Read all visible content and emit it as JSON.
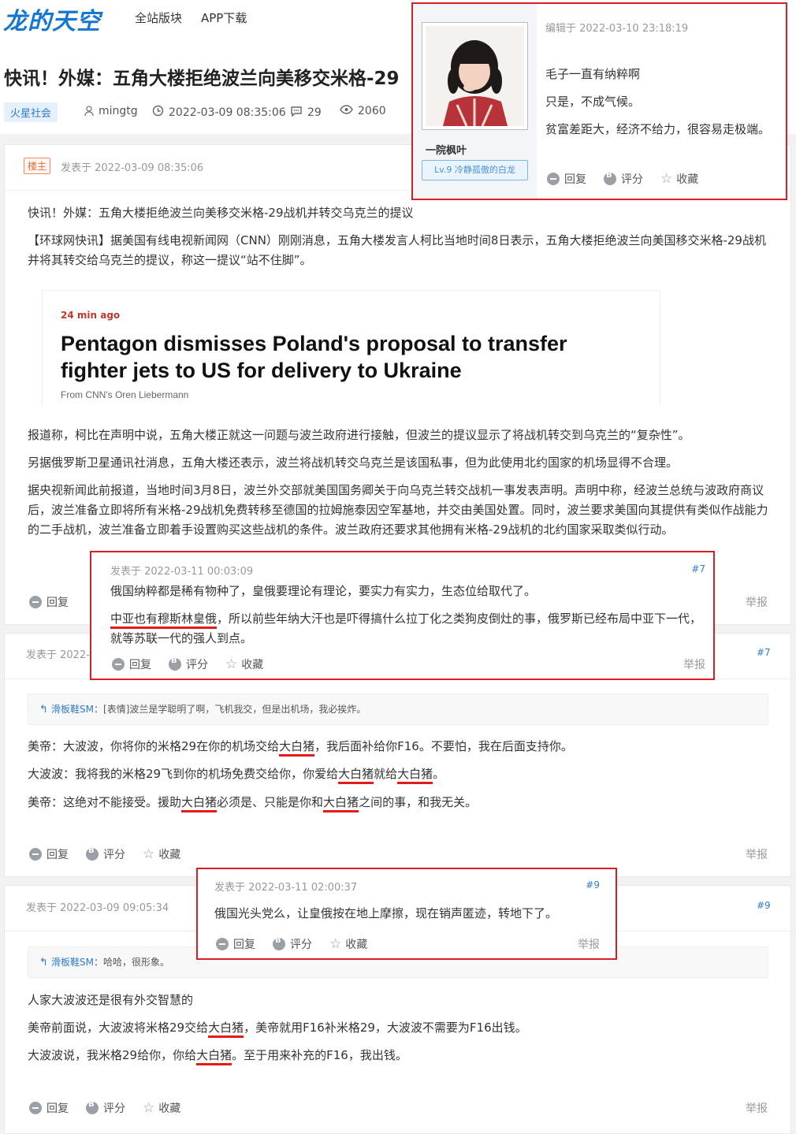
{
  "header": {
    "logo": "龙的天空",
    "nav": [
      "全站版块",
      "APP下载"
    ],
    "title": "快讯！外媒：五角大楼拒绝波兰向美移交米格-29",
    "tag": "火星社会",
    "author": "mingtg",
    "time": "2022-03-09 08:35:06",
    "replies": "29",
    "views": "2060"
  },
  "popup_user": {
    "edited": "编辑于 2022-03-10 23:18:19",
    "name": "一院枫叶",
    "level": "Lv.9 冷静孤傲的白龙",
    "lines": [
      "毛子一直有纳粹啊",
      "只是，不成气候。",
      "贫富差距大，经济不给力，很容易走极端。"
    ]
  },
  "actions": {
    "reply": "回复",
    "rate": "评分",
    "fav": "收藏",
    "report": "举报"
  },
  "post1": {
    "badge": "楼主",
    "time": "发表于 2022-03-09 08:35:06",
    "p1": "快讯！外媒：五角大楼拒绝波兰向美移交米格-29战机并转交乌克兰的提议",
    "p2": "【环球网快讯】据美国有线电视新闻网（CNN）刚刚消息，五角大楼发言人柯比当地时间8日表示，五角大楼拒绝波兰向美国移交米格-29战机并将其转交给乌克兰的提议，称这一提议“站不住脚”。",
    "cnn_time": "24 min ago",
    "cnn_head": "Pentagon dismisses Poland's proposal to transfer fighter jets to US for delivery to Ukraine",
    "cnn_by": "From CNN's Oren Liebermann",
    "p3": "报道称，柯比在声明中说，五角大楼正就这一问题与波兰政府进行接触，但波兰的提议显示了将战机转交到乌克兰的“复杂性”。",
    "p4": "另据俄罗斯卫星通讯社消息，五角大楼还表示，波兰将战机转交乌克兰是该国私事，但为此使用北约国家的机场显得不合理。",
    "p5": "据央视新闻此前报道，当地时间3月8日，波兰外交部就美国国务卿关于向乌克兰转交战机一事发表声明。声明中称，经波兰总统与波政府商议后，波兰准备立即将所有米格-29战机免费转移至德国的拉姆施泰因空军基地，并交由美国处置。同时，波兰要求美国向其提供有类似作战能力的二手战机，波兰准备立即着手设置购买这些战机的条件。波兰政府还要求其他拥有米格-29战机的北约国家采取类似行动。"
  },
  "popup7": {
    "time": "发表于 2022-03-11 00:03:09",
    "floor": "#7",
    "l1": "俄国纳粹都是稀有物种了，皇俄要理论有理论，要实力有实力，生态位给取代了。",
    "l2a": "中亚也有穆斯林皇俄",
    "l2b": "，所以前些年纳大汗也是吓得搞什么拉丁化之类狗皮倒灶的事，俄罗斯已经布局中亚下一代，就等苏联一代的强人到点。"
  },
  "post2": {
    "time": "发表于 2022-",
    "floor": "#7",
    "quote_who": "滑板鞋SM",
    "quote_text": "：[表情]波兰是学聪明了啊，飞机我交，但是出机场，我必挨炸。",
    "l1a": "美帝：大波波，你将你的米格29在你的机场交给",
    "hl": "大白猪",
    "l1b": "，我后面补给你F16。不要怕，我在后面支持你。",
    "l2a": "大波波：我将我的米格29飞到你的机场免费交给你，你爱给",
    "l2b": "就给",
    "l2c": "。",
    "l3a": "美帝：这绝对不能接受。援助",
    "l3b": "必须是、只能是你和",
    "l3c": "之间的事，和我无关。"
  },
  "popup9": {
    "time": "发表于 2022-03-11 02:00:37",
    "floor": "#9",
    "text": "俄国光头党么，让皇俄按在地上摩擦，现在销声匿迹，转地下了。"
  },
  "post3": {
    "time": "发表于 2022-03-09 09:05:34",
    "floor": "#9",
    "quote_who": "滑板鞋SM",
    "quote_text": "：哈哈，很形象。",
    "l1": "人家大波波还是很有外交智慧的",
    "l2a": "美帝前面说，大波波将米格29交给",
    "l2b": "，美帝就用F16补米格29，大波波不需要为F16出钱。",
    "l3a": "大波波说，我米格29给你，你给",
    "l3b": "。至于用来补充的F16，我出钱。"
  },
  "colors": {
    "accent": "#1677d2",
    "highlight_box": "#d61f26",
    "underline": "#e31b1b"
  }
}
